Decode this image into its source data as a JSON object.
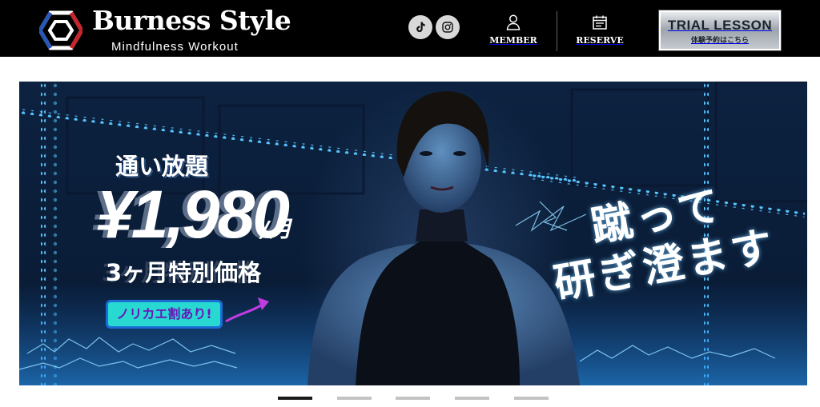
{
  "header": {
    "brand_name": "Burness Style",
    "tagline": "Mindfulness  Workout",
    "social": [
      {
        "name": "tiktok",
        "icon": "tiktok-icon"
      },
      {
        "name": "instagram",
        "icon": "instagram-icon"
      }
    ],
    "nav": {
      "member_label": "MEMBER",
      "reserve_label": "RESERVE"
    },
    "trial_button": {
      "main": "TRIAL LESSON",
      "sub": "体験予約はこちら"
    }
  },
  "hero": {
    "promo_line1": "通い放題",
    "price": "¥1,980",
    "price_unit": "/月",
    "promo_line3": "3ヶ月特別価格",
    "badge": "ノリカエ割あり!",
    "slogan_line1": "蹴って",
    "slogan_line2": "研ぎ澄ます"
  },
  "pager": {
    "count": 5,
    "active_index": 0
  },
  "colors": {
    "header_bg": "#000000",
    "badge_bg": "#27d9d1",
    "badge_text": "#6a16b8",
    "led_blue": "#4fb8ff",
    "pager_active": "#1a1a1a",
    "pager_inactive": "#c3c3c3"
  }
}
